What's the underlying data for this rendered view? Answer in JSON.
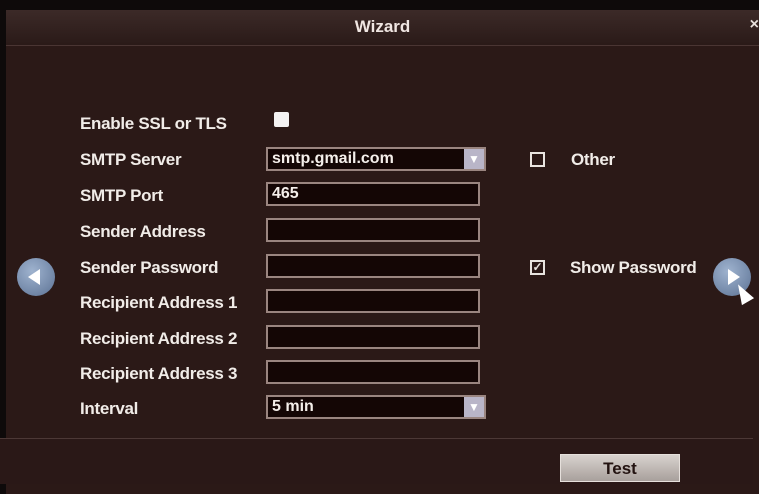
{
  "window": {
    "title": "Wizard",
    "close_symbol": "×"
  },
  "form": {
    "ssl_label": "Enable SSL or TLS",
    "smtp_server_label": "SMTP Server",
    "smtp_server_value": "smtp.gmail.com",
    "other_label": "Other",
    "smtp_port_label": "SMTP Port",
    "smtp_port_value": "465",
    "sender_address_label": "Sender Address",
    "sender_address_value": "",
    "sender_password_label": "Sender Password",
    "sender_password_value": "",
    "show_password_label": "Show Password",
    "recipient1_label": "Recipient Address 1",
    "recipient1_value": "",
    "recipient2_label": "Recipient Address 2",
    "recipient2_value": "",
    "recipient3_label": "Recipient Address 3",
    "recipient3_value": "",
    "interval_label": "Interval",
    "interval_value": "5 min"
  },
  "checkbox_state": {
    "ssl": false,
    "other": false,
    "show_password": true
  },
  "footer": {
    "test_label": "Test"
  },
  "icons": {
    "prev": "chevron-left-icon",
    "next": "chevron-right-icon",
    "dropdown": "chevron-down-icon"
  }
}
